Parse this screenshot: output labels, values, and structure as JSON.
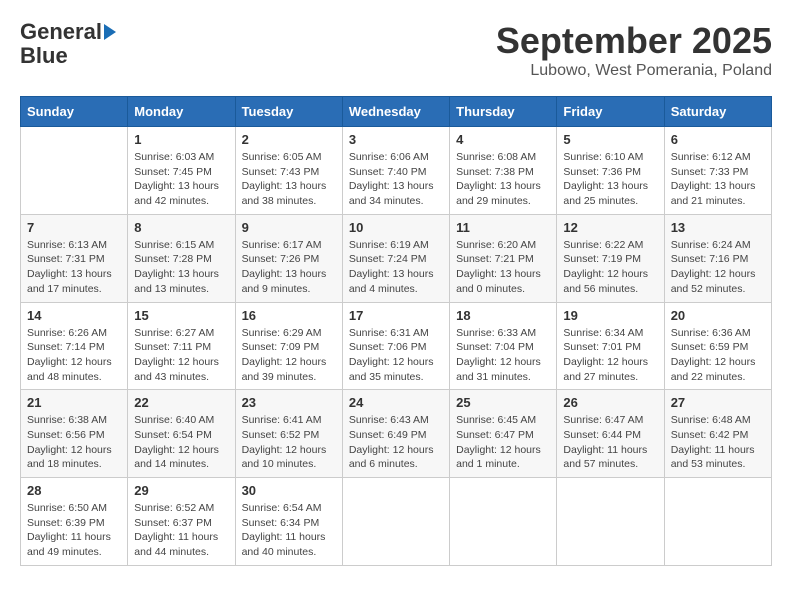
{
  "logo": {
    "line1": "General",
    "line2": "Blue"
  },
  "header": {
    "month": "September 2025",
    "location": "Lubowo, West Pomerania, Poland"
  },
  "days_of_week": [
    "Sunday",
    "Monday",
    "Tuesday",
    "Wednesday",
    "Thursday",
    "Friday",
    "Saturday"
  ],
  "weeks": [
    [
      {
        "day": "",
        "info": ""
      },
      {
        "day": "1",
        "info": "Sunrise: 6:03 AM\nSunset: 7:45 PM\nDaylight: 13 hours\nand 42 minutes."
      },
      {
        "day": "2",
        "info": "Sunrise: 6:05 AM\nSunset: 7:43 PM\nDaylight: 13 hours\nand 38 minutes."
      },
      {
        "day": "3",
        "info": "Sunrise: 6:06 AM\nSunset: 7:40 PM\nDaylight: 13 hours\nand 34 minutes."
      },
      {
        "day": "4",
        "info": "Sunrise: 6:08 AM\nSunset: 7:38 PM\nDaylight: 13 hours\nand 29 minutes."
      },
      {
        "day": "5",
        "info": "Sunrise: 6:10 AM\nSunset: 7:36 PM\nDaylight: 13 hours\nand 25 minutes."
      },
      {
        "day": "6",
        "info": "Sunrise: 6:12 AM\nSunset: 7:33 PM\nDaylight: 13 hours\nand 21 minutes."
      }
    ],
    [
      {
        "day": "7",
        "info": "Sunrise: 6:13 AM\nSunset: 7:31 PM\nDaylight: 13 hours\nand 17 minutes."
      },
      {
        "day": "8",
        "info": "Sunrise: 6:15 AM\nSunset: 7:28 PM\nDaylight: 13 hours\nand 13 minutes."
      },
      {
        "day": "9",
        "info": "Sunrise: 6:17 AM\nSunset: 7:26 PM\nDaylight: 13 hours\nand 9 minutes."
      },
      {
        "day": "10",
        "info": "Sunrise: 6:19 AM\nSunset: 7:24 PM\nDaylight: 13 hours\nand 4 minutes."
      },
      {
        "day": "11",
        "info": "Sunrise: 6:20 AM\nSunset: 7:21 PM\nDaylight: 13 hours\nand 0 minutes."
      },
      {
        "day": "12",
        "info": "Sunrise: 6:22 AM\nSunset: 7:19 PM\nDaylight: 12 hours\nand 56 minutes."
      },
      {
        "day": "13",
        "info": "Sunrise: 6:24 AM\nSunset: 7:16 PM\nDaylight: 12 hours\nand 52 minutes."
      }
    ],
    [
      {
        "day": "14",
        "info": "Sunrise: 6:26 AM\nSunset: 7:14 PM\nDaylight: 12 hours\nand 48 minutes."
      },
      {
        "day": "15",
        "info": "Sunrise: 6:27 AM\nSunset: 7:11 PM\nDaylight: 12 hours\nand 43 minutes."
      },
      {
        "day": "16",
        "info": "Sunrise: 6:29 AM\nSunset: 7:09 PM\nDaylight: 12 hours\nand 39 minutes."
      },
      {
        "day": "17",
        "info": "Sunrise: 6:31 AM\nSunset: 7:06 PM\nDaylight: 12 hours\nand 35 minutes."
      },
      {
        "day": "18",
        "info": "Sunrise: 6:33 AM\nSunset: 7:04 PM\nDaylight: 12 hours\nand 31 minutes."
      },
      {
        "day": "19",
        "info": "Sunrise: 6:34 AM\nSunset: 7:01 PM\nDaylight: 12 hours\nand 27 minutes."
      },
      {
        "day": "20",
        "info": "Sunrise: 6:36 AM\nSunset: 6:59 PM\nDaylight: 12 hours\nand 22 minutes."
      }
    ],
    [
      {
        "day": "21",
        "info": "Sunrise: 6:38 AM\nSunset: 6:56 PM\nDaylight: 12 hours\nand 18 minutes."
      },
      {
        "day": "22",
        "info": "Sunrise: 6:40 AM\nSunset: 6:54 PM\nDaylight: 12 hours\nand 14 minutes."
      },
      {
        "day": "23",
        "info": "Sunrise: 6:41 AM\nSunset: 6:52 PM\nDaylight: 12 hours\nand 10 minutes."
      },
      {
        "day": "24",
        "info": "Sunrise: 6:43 AM\nSunset: 6:49 PM\nDaylight: 12 hours\nand 6 minutes."
      },
      {
        "day": "25",
        "info": "Sunrise: 6:45 AM\nSunset: 6:47 PM\nDaylight: 12 hours\nand 1 minute."
      },
      {
        "day": "26",
        "info": "Sunrise: 6:47 AM\nSunset: 6:44 PM\nDaylight: 11 hours\nand 57 minutes."
      },
      {
        "day": "27",
        "info": "Sunrise: 6:48 AM\nSunset: 6:42 PM\nDaylight: 11 hours\nand 53 minutes."
      }
    ],
    [
      {
        "day": "28",
        "info": "Sunrise: 6:50 AM\nSunset: 6:39 PM\nDaylight: 11 hours\nand 49 minutes."
      },
      {
        "day": "29",
        "info": "Sunrise: 6:52 AM\nSunset: 6:37 PM\nDaylight: 11 hours\nand 44 minutes."
      },
      {
        "day": "30",
        "info": "Sunrise: 6:54 AM\nSunset: 6:34 PM\nDaylight: 11 hours\nand 40 minutes."
      },
      {
        "day": "",
        "info": ""
      },
      {
        "day": "",
        "info": ""
      },
      {
        "day": "",
        "info": ""
      },
      {
        "day": "",
        "info": ""
      }
    ]
  ]
}
